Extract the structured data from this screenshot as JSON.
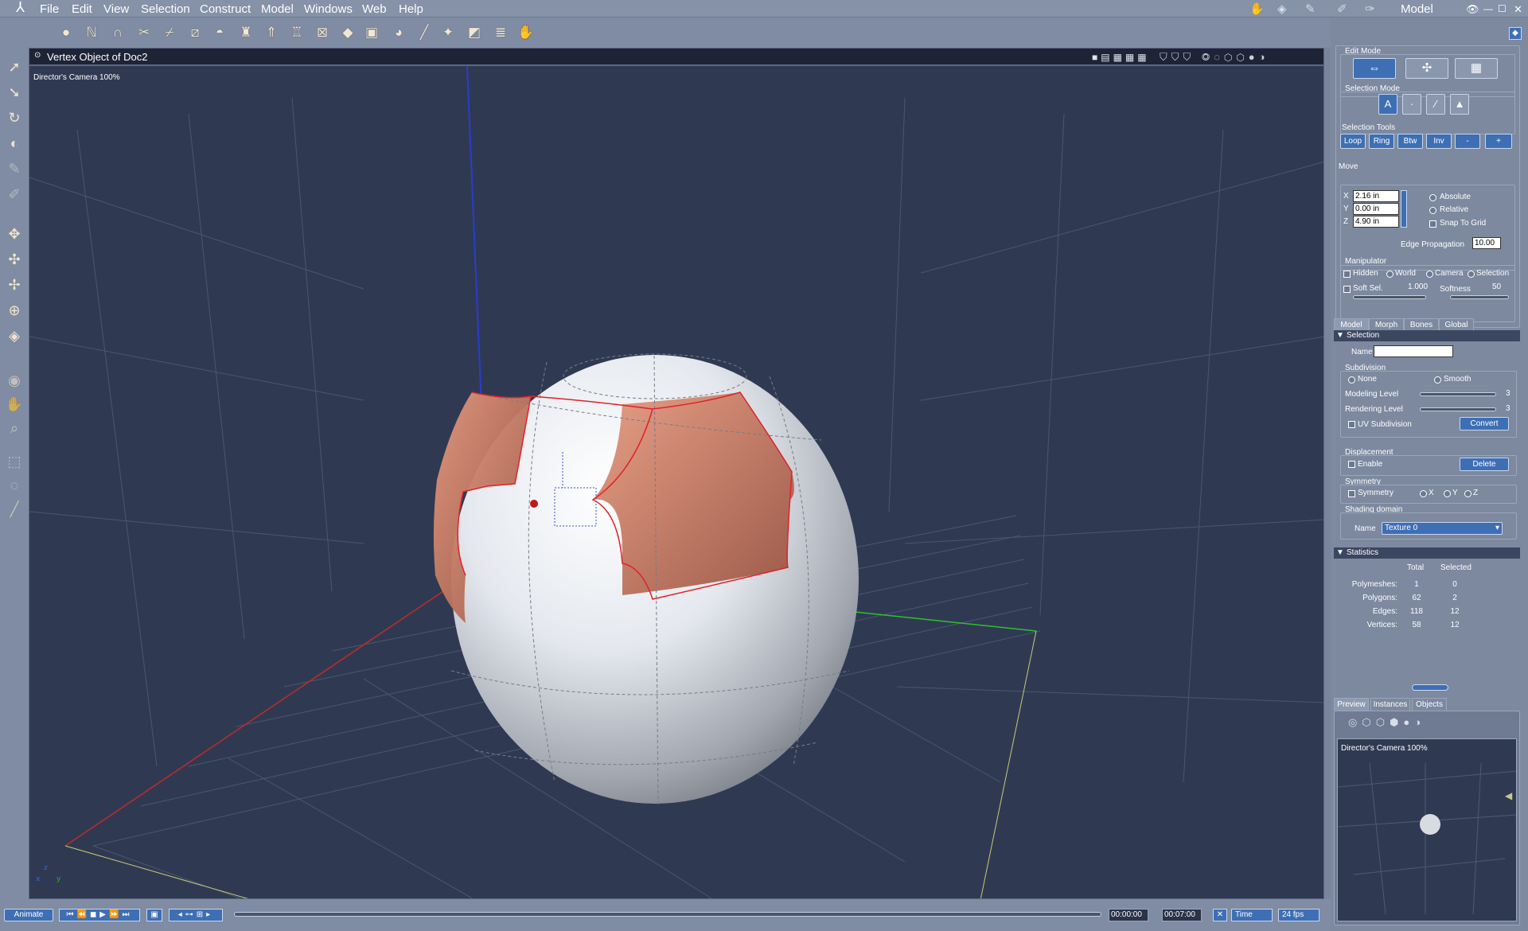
{
  "menubar": {
    "items": [
      "File",
      "Edit",
      "View",
      "Selection",
      "Construct",
      "Model",
      "Windows",
      "Web",
      "Help"
    ],
    "room_label": "Model"
  },
  "document": {
    "title": "Vertex Object of Doc2",
    "camera_label": "Director's Camera 100%"
  },
  "edit_mode": {
    "label": "Edit Mode"
  },
  "selection_mode": {
    "label": "Selection Mode"
  },
  "selection_tools": {
    "label": "Selection Tools",
    "buttons": [
      "Loop",
      "Ring",
      "Btw",
      "Inv",
      "-",
      "+"
    ]
  },
  "move": {
    "label": "Move",
    "x_label": "X",
    "x_value": "2.16 in",
    "y_label": "Y",
    "y_value": "0.00 in",
    "z_label": "Z",
    "z_value": "4.90 in",
    "absolute": "Absolute",
    "relative": "Relative",
    "snap": "Snap To Grid",
    "edge_prop_label": "Edge Propagation",
    "edge_prop_value": "10.00"
  },
  "manipulator": {
    "label": "Manipulator",
    "hidden": "Hidden",
    "world": "World",
    "camera": "Camera",
    "selection": "Selection",
    "soft_sel": "Soft Sel.",
    "soft_sel_value": "1.000",
    "softness": "Softness",
    "softness_value": "50"
  },
  "tabs": [
    "Model",
    "Morph",
    "Bones",
    "Global"
  ],
  "selection_section": {
    "header": "Selection",
    "name_label": "Name",
    "subdivision_label": "Subdivision",
    "none": "None",
    "smooth": "Smooth",
    "modeling_level": "Modeling Level",
    "modeling_value": "3",
    "rendering_level": "Rendering Level",
    "rendering_value": "3",
    "uv_subdiv": "UV Subdivision",
    "convert": "Convert",
    "displacement_label": "Displacement",
    "enable": "Enable",
    "delete": "Delete",
    "symmetry_label": "Symmetry",
    "symmetry": "Symmetry",
    "x": "X",
    "y": "Y",
    "z": "Z",
    "shading_label": "Shading domain",
    "shading_name_label": "Name",
    "shading_value": "Texture 0"
  },
  "statistics": {
    "header": "Statistics",
    "col_total": "Total",
    "col_selected": "Selected",
    "rows": [
      {
        "label": "Polymeshes:",
        "total": "1",
        "selected": "0"
      },
      {
        "label": "Polygons:",
        "total": "62",
        "selected": "2"
      },
      {
        "label": "Edges:",
        "total": "118",
        "selected": "12"
      },
      {
        "label": "Vertices:",
        "total": "58",
        "selected": "12"
      }
    ]
  },
  "preview_tabs": [
    "Preview",
    "Instances",
    "Objects"
  ],
  "preview": {
    "camera_label": "Director's Camera 100%"
  },
  "timeline": {
    "animate": "Animate",
    "start_time": "00:00:00",
    "end_time": "00:07:00",
    "time_unit": "Time",
    "fps": "24 fps"
  },
  "colors": {
    "viewport_bg": "#2f3a52",
    "selection_fill": "#d07a62",
    "accent_blue": "#3e6fb4"
  }
}
